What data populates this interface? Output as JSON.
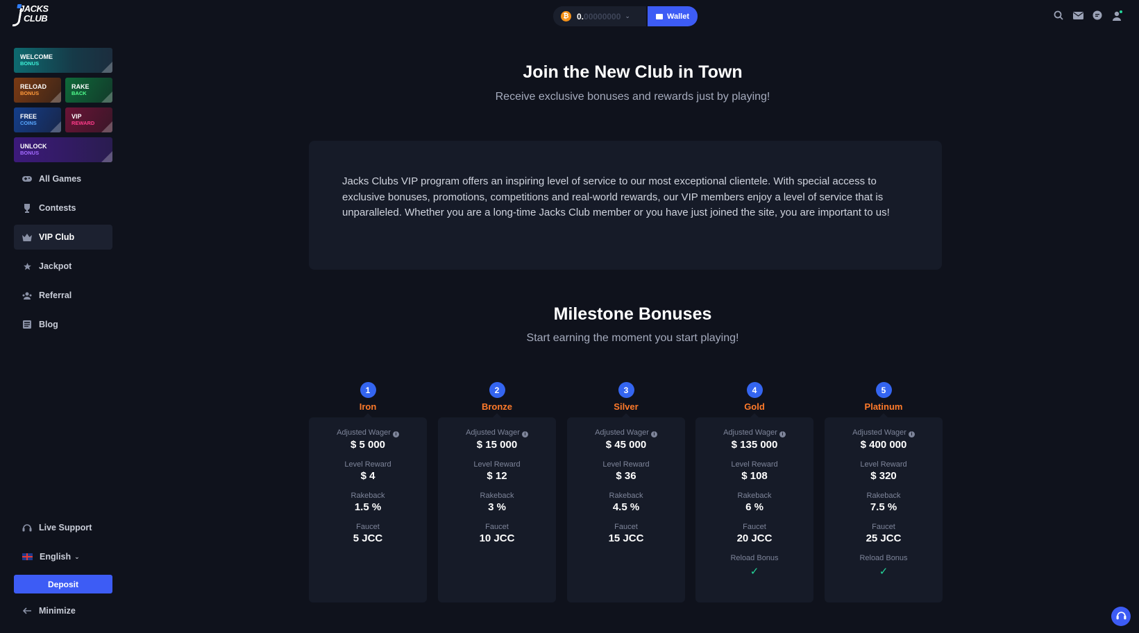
{
  "logo": {
    "line1": "JACKS",
    "line2": "CLUB"
  },
  "promos": {
    "welcome": {
      "line1": "WELCOME",
      "line2": "BONUS"
    },
    "reload": {
      "line1": "RELOAD",
      "line2": "BONUS"
    },
    "rake": {
      "line1": "RAKE",
      "line2": "BACK"
    },
    "free": {
      "line1": "FREE",
      "line2": "COINS"
    },
    "vip": {
      "line1": "VIP",
      "line2": "REWARD"
    },
    "unlock": {
      "line1": "UNLOCK",
      "line2": "BONUS"
    }
  },
  "nav": {
    "all_games": "All Games",
    "contests": "Contests",
    "vip_club": "VIP Club",
    "jackpot": "Jackpot",
    "referral": "Referral",
    "blog": "Blog",
    "active": "vip_club"
  },
  "sidebar_bottom": {
    "live_support": "Live Support",
    "language": "English",
    "deposit": "Deposit",
    "minimize": "Minimize"
  },
  "topbar": {
    "balance_main": "0.",
    "balance_dim": "00000000",
    "currency_icon": "bitcoin-icon",
    "wallet": "Wallet",
    "icons": [
      "search-icon",
      "mail-icon",
      "chat-icon",
      "profile-icon"
    ]
  },
  "hero": {
    "title": "Join the New Club in Town",
    "subtitle": "Receive exclusive bonuses and rewards just by playing!",
    "intro": "Jacks Clubs VIP program offers an inspiring level of service to our most exceptional clientele. With special access to exclusive bonuses, promotions, competitions and real-world rewards, our VIP members enjoy a level of service that is unparalleled. Whether you are a long-time Jacks Club member or you have just joined the site, you are important to us!"
  },
  "milestones_section": {
    "title": "Milestone Bonuses",
    "subtitle": "Start earning the moment you start playing!",
    "labels": {
      "wager": "Adjusted Wager",
      "reward": "Level Reward",
      "rakeback": "Rakeback",
      "faucet": "Faucet",
      "reload": "Reload Bonus"
    },
    "levels": [
      {
        "num": "1",
        "name": "Iron",
        "wager": "$ 5 000",
        "reward": "$ 4",
        "rakeback": "1.5 %",
        "faucet": "5 JCC",
        "reload": false
      },
      {
        "num": "2",
        "name": "Bronze",
        "wager": "$ 15 000",
        "reward": "$ 12",
        "rakeback": "3 %",
        "faucet": "10 JCC",
        "reload": false
      },
      {
        "num": "3",
        "name": "Silver",
        "wager": "$ 45 000",
        "reward": "$ 36",
        "rakeback": "4.5 %",
        "faucet": "15 JCC",
        "reload": false
      },
      {
        "num": "4",
        "name": "Gold",
        "wager": "$ 135 000",
        "reward": "$ 108",
        "rakeback": "6 %",
        "faucet": "20 JCC",
        "reload": true
      },
      {
        "num": "5",
        "name": "Platinum",
        "wager": "$ 400 000",
        "reward": "$ 320",
        "rakeback": "7.5 %",
        "faucet": "25 JCC",
        "reload": true
      }
    ]
  },
  "colors": {
    "background": "#0f121c",
    "card": "#161b28",
    "accent_blue": "#3d5cf5",
    "level_name": "#ff7a2a",
    "check": "#24d69a"
  }
}
